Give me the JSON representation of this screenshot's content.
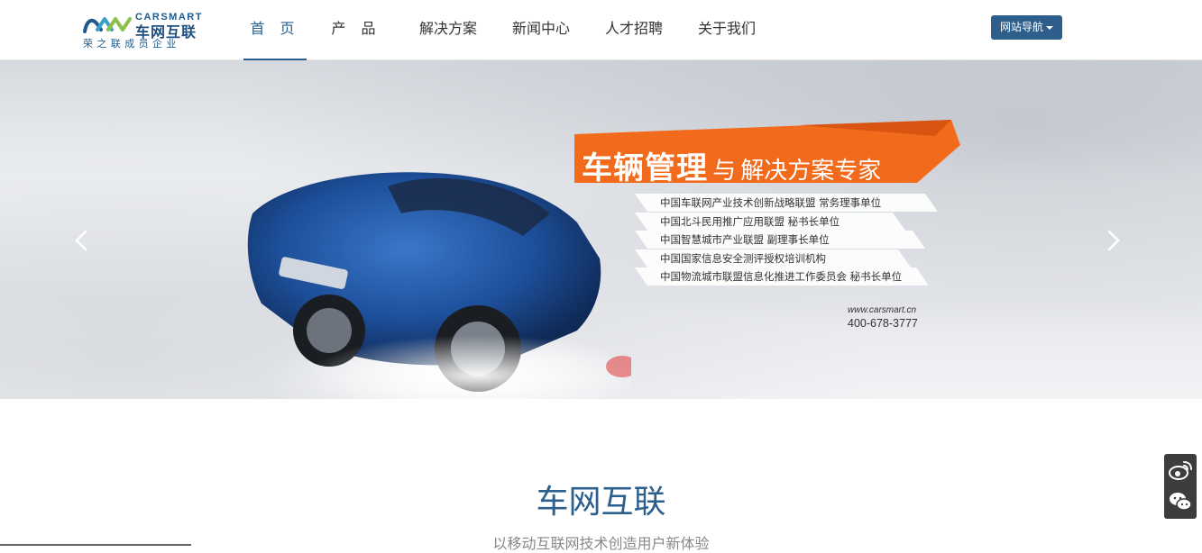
{
  "logo": {
    "en": "CARSMART",
    "cn": "车网互联",
    "sub": "荣之联成员企业"
  },
  "nav": {
    "items": [
      "首 页",
      "产 品",
      "解决方案",
      "新闻中心",
      "人才招聘",
      "关于我们"
    ],
    "active_index": 0,
    "site_nav_label": "网站导航"
  },
  "banner": {
    "headline_big": "车辆管理",
    "headline_small": "与",
    "headline_rest": "解决方案专家",
    "slogans": [
      "中国车联网产业技术创新战略联盟  常务理事单位",
      "中国北斗民用推广应用联盟  秘书长单位",
      "中国智慧城市产业联盟  副理事长单位",
      "中国国家信息安全测评授权培训机构",
      "中国物流城市联盟信息化推进工作委员会 秘书长单位"
    ],
    "url": "www.carsmart.cn",
    "tel": "400-678-3777",
    "accent_color": "#f26a1b"
  },
  "intro": {
    "title": "车网互联",
    "subtitle": "以移动互联网技术创造用户新体验"
  },
  "side": {
    "icons": [
      "weibo-icon",
      "wechat-icon"
    ]
  },
  "colors": {
    "brand": "#2b5f8e",
    "button": "#2d5e8c",
    "side_panel": "#3d3d3d"
  }
}
